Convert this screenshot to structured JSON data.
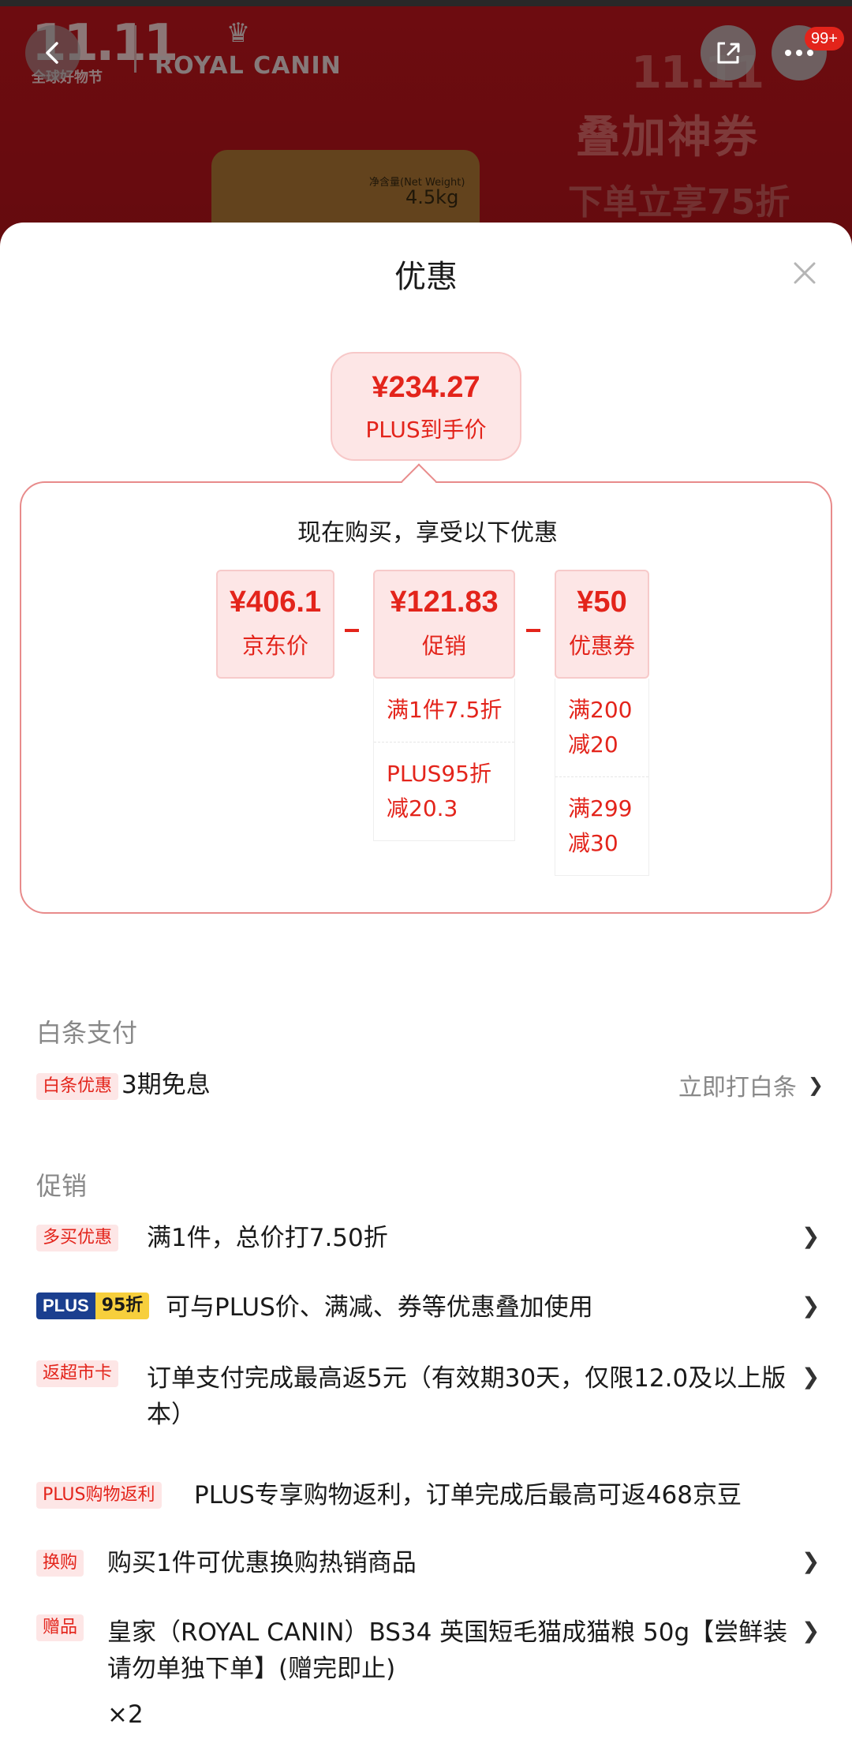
{
  "banner": {
    "promo_number": "11.11",
    "promo_event": "全球好物节",
    "brand": "ROYAL CANIN",
    "product_weight_label": "净含量(Net Weight)",
    "product_weight": "4.5kg",
    "promo_line1": "11.11",
    "promo_line2": "叠加神券",
    "promo_line3": "下单立享75折",
    "message_badge": "99+"
  },
  "sheet": {
    "title": "优惠",
    "final_price": "¥234.27",
    "final_price_label": "PLUS到手价",
    "calc_subtitle": "现在购买，享受以下优惠",
    "jd_price": {
      "value": "¥406.1",
      "label": "京东价"
    },
    "promo": {
      "value": "¥121.83",
      "label": "促销",
      "items": [
        "满1件7.5折",
        "PLUS95折\n减20.3"
      ]
    },
    "coupon": {
      "value": "¥50",
      "label": "优惠券",
      "items": [
        "满200\n减20",
        "满299\n减30"
      ]
    }
  },
  "baitiao": {
    "section_title": "白条支付",
    "tag": "白条优惠",
    "text": "3期免息",
    "action": "立即打白条",
    "chevron": "❯"
  },
  "promotions": {
    "section_title": "促销",
    "items": [
      {
        "tag": "多买优惠",
        "text": "满1件，总价打7.50折"
      },
      {
        "tag_plus": "PLUS",
        "tag_95": "95折",
        "text": "可与PLUS价、满减、券等优惠叠加使用"
      },
      {
        "tag": "返超市卡",
        "text": "订单支付完成最高返5元（有效期30天，仅限12.0及以上版本）"
      },
      {
        "tag": "PLUS购物返利",
        "text": "PLUS专享购物返利，订单完成后最高可返468京豆"
      },
      {
        "tag": "换购",
        "text": "购买1件可优惠换购热销商品"
      },
      {
        "tag": "赠品",
        "text": "皇家（ROYAL CANIN）BS34 英国短毛猫成猫粮  50g【尝鲜装 请勿单独下单】(赠完即止)",
        "quantity": "×2"
      }
    ],
    "chevron": "❯"
  },
  "icons": [
    "back-icon",
    "share-icon",
    "more-icon",
    "close-icon",
    "chevron-right-icon"
  ],
  "colors": {
    "accent_red": "#e3241b",
    "light_red_bg": "#fde6e6",
    "gray_text": "#888888",
    "plus_blue": "#1b3f8f",
    "plus_gold": "#f7cf3c"
  }
}
